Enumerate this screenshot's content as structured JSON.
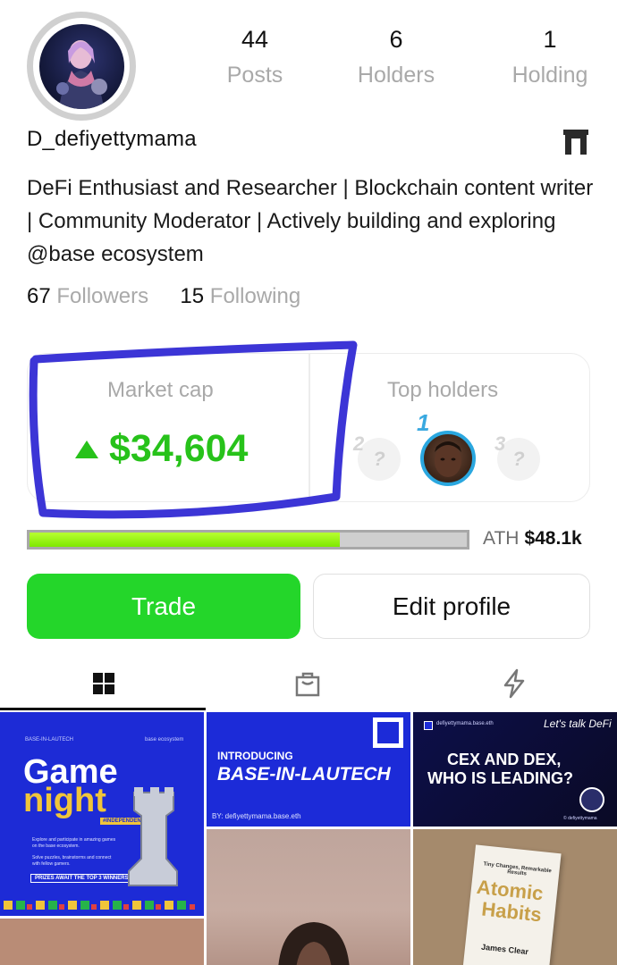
{
  "profile": {
    "username": "D_defiyettymama",
    "bio": "DeFi Enthusiast and Researcher | Blockchain content writer | Community Moderator | Actively building and exploring @base ecosystem",
    "avatar_icon": "profile-avatar"
  },
  "stats": [
    {
      "value": "44",
      "label": "Posts"
    },
    {
      "value": "6",
      "label": "Holders"
    },
    {
      "value": "1",
      "label": "Holding"
    }
  ],
  "follow": {
    "followers_count": "67",
    "followers_label": "Followers",
    "following_count": "15",
    "following_label": "Following"
  },
  "market": {
    "label": "Market cap",
    "value": "$34,604",
    "trend": "up",
    "color": "#27c21a"
  },
  "top_holders": {
    "label": "Top holders",
    "ranks": [
      "1",
      "2",
      "3"
    ]
  },
  "progress": {
    "fraction": 0.71,
    "ath_label": "ATH",
    "ath_value": "$48.1k"
  },
  "buttons": {
    "trade": "Trade",
    "edit_profile": "Edit profile"
  },
  "tabs": [
    {
      "icon": "grid-icon",
      "active": true
    },
    {
      "icon": "shopping-bag-icon",
      "active": false
    },
    {
      "icon": "lightning-icon",
      "active": false
    }
  ],
  "posts": {
    "p1": {
      "top_left": "BASE-IN-LAUTECH",
      "top_right": "base ecosystem",
      "title_line1": "Game",
      "title_line2": "night",
      "badge": "#INDEPENDENCE",
      "bullet1": "Explore and participate in amazing games on the base ecosystem.",
      "bullet2": "Solve puzzles, brainstorms and connect with fellow gamers.",
      "footer": "PRIZES AWAIT THE TOP 3 WINNERS!"
    },
    "p2": {
      "line1": "INTRODUCING",
      "line2": "BASE-IN-LAUTECH",
      "byline": "BY: defiyettymama.base.eth"
    },
    "p3": {
      "handle": "defiyettymama.base.eth",
      "tagline": "Let's talk DeFi",
      "line1": "CEX AND DEX,",
      "line2": "WHO IS LEADING?",
      "credit": "© defiyettymama"
    },
    "p6": {
      "subtitle": "Tiny Changes, Remarkable Results",
      "title1": "Atomic",
      "title2": "Habits",
      "author": "James Clear"
    }
  },
  "colors": {
    "trade_button": "#24d62a",
    "base_blue": "#1c2bd8",
    "progress_fill": "#8cf21a"
  }
}
